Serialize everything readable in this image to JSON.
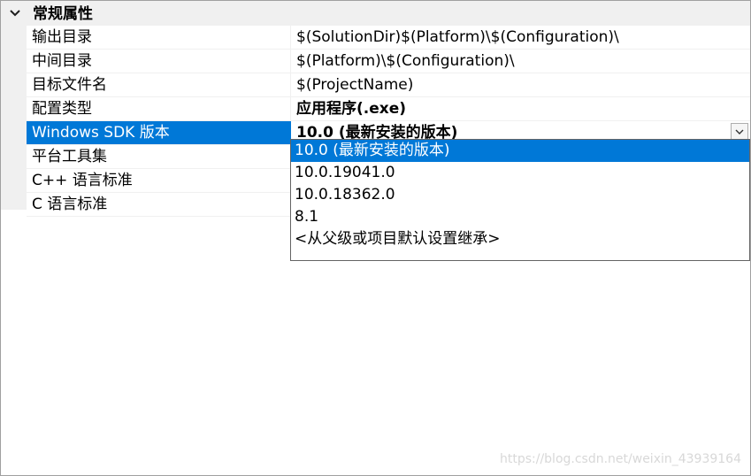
{
  "section": {
    "title": "常规属性",
    "chevron_icon": "chevron-down-icon"
  },
  "properties": [
    {
      "name": "输出目录",
      "value": "$(SolutionDir)$(Platform)\\$(Configuration)\\"
    },
    {
      "name": "中间目录",
      "value": "$(Platform)\\$(Configuration)\\"
    },
    {
      "name": "目标文件名",
      "value": "$(ProjectName)"
    },
    {
      "name": "配置类型",
      "value": "应用程序(.exe)"
    },
    {
      "name": "Windows SDK 版本",
      "value": "10.0 (最新安装的版本)"
    },
    {
      "name": "平台工具集",
      "value": ""
    },
    {
      "name": "C++ 语言标准",
      "value": ""
    },
    {
      "name": "C 语言标准",
      "value": ""
    }
  ],
  "dropdown": {
    "options": [
      "10.0 (最新安装的版本)",
      "10.0.19041.0",
      "10.0.18362.0",
      "8.1",
      "<从父级或项目默认设置继承>"
    ],
    "selected_index": 0,
    "arrow_icon": "chevron-down-icon"
  },
  "watermark": "https://blog.csdn.net/weixin_43939164",
  "colors": {
    "selection": "#0078d7",
    "header_bg": "#f0f0f0",
    "grid_line": "#f0f0f0"
  }
}
